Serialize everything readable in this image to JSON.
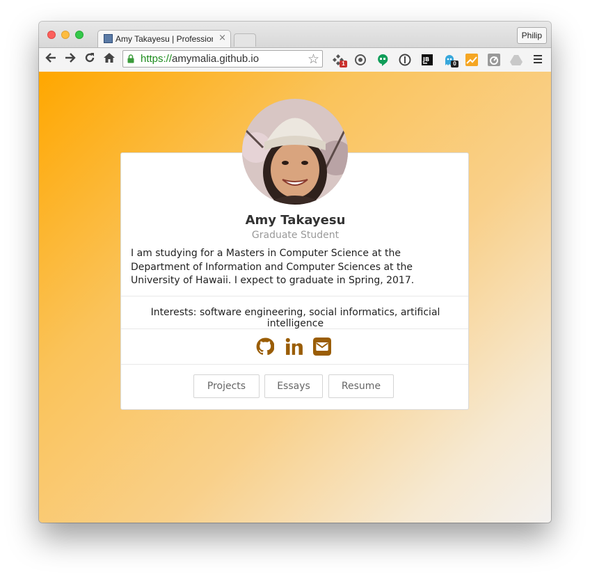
{
  "browser": {
    "tab_title": "Amy Takayesu | Professional",
    "tab_close": "×",
    "profile_name": "Philip",
    "url_scheme": "https://",
    "url_host": "amymalia.github.io",
    "extension_badges": [
      "1",
      "0"
    ]
  },
  "profile": {
    "name": "Amy Takayesu",
    "subtitle": "Graduate Student",
    "bio": "I am studying for a Masters in Computer Science at the Department of Information and Computer Sciences at the University of Hawaii. I expect to graduate in Spring, 2017.",
    "interests": "Interests: software engineering, social informatics, artificial intelligence"
  },
  "social_links": [
    {
      "icon": "github-icon",
      "color": "#9a5d05"
    },
    {
      "icon": "linkedin-icon",
      "color": "#9a5d05"
    },
    {
      "icon": "envelope-icon",
      "color": "#9a5d05"
    }
  ],
  "buttons": {
    "projects": "Projects",
    "essays": "Essays",
    "resume": "Resume"
  },
  "colors": {
    "gradient_start": "#ffa700",
    "gradient_end": "#f3f1ef",
    "icon_accent": "#9a5d05",
    "secure_green": "#1e8c1e"
  }
}
